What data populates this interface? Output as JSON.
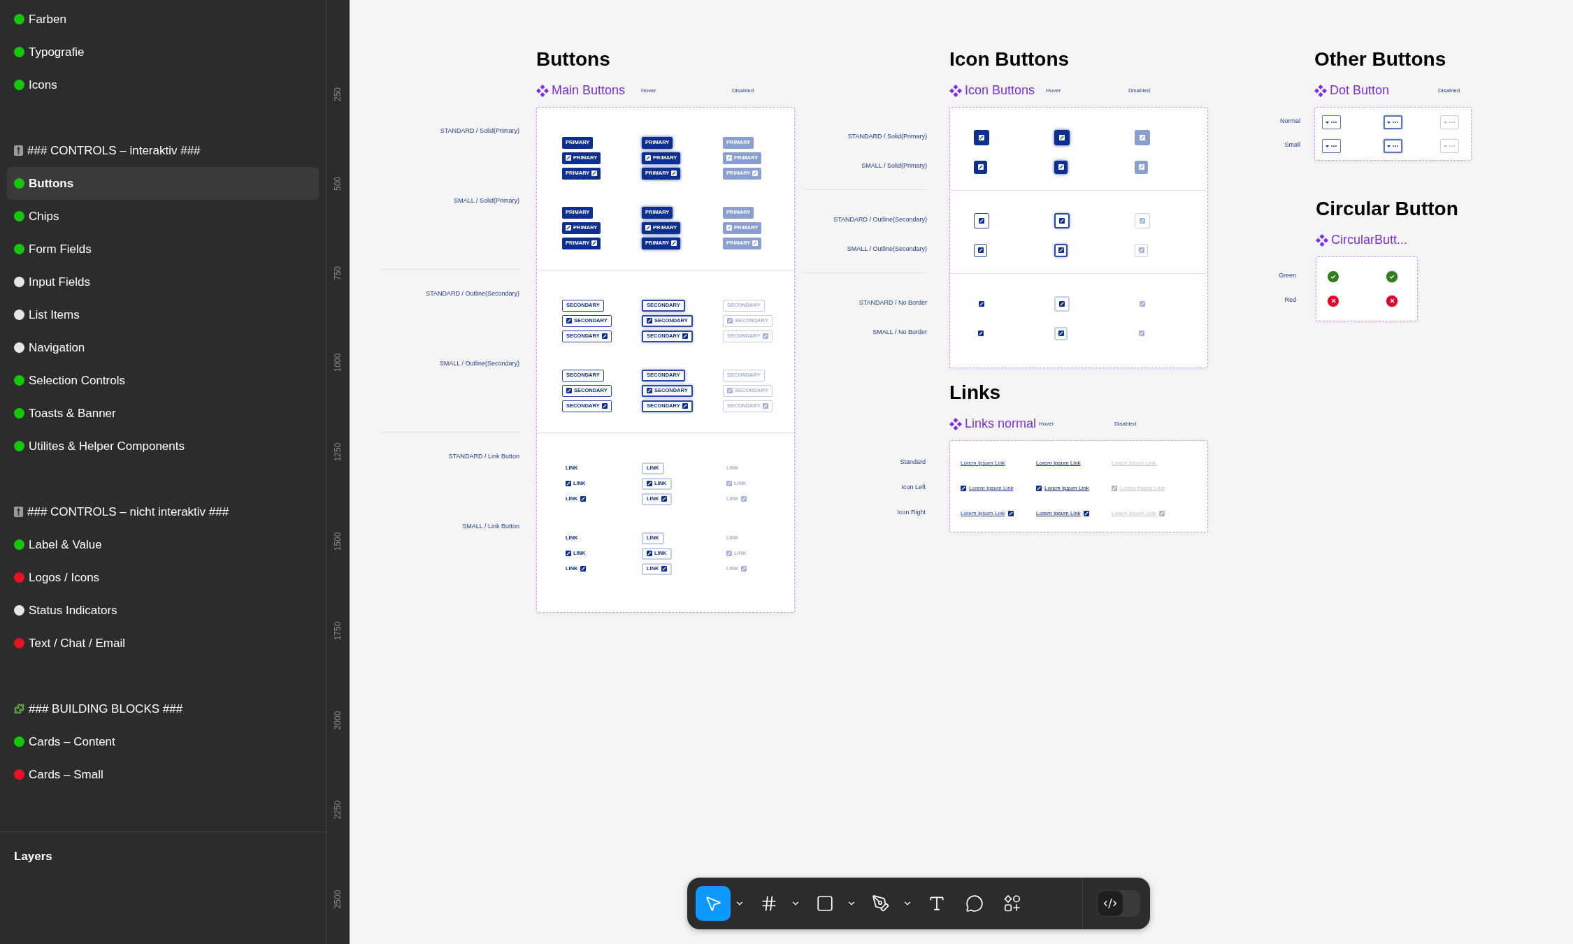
{
  "sidebar": {
    "groups": [
      {
        "items": [
          {
            "label": "Farben",
            "color": "#16c60c",
            "selected": false
          },
          {
            "label": "Typografie",
            "color": "#16c60c",
            "selected": false
          },
          {
            "label": "Icons",
            "color": "#16c60c",
            "selected": false
          }
        ]
      },
      {
        "header": {
          "kind": "controls",
          "label": "### CONTROLS – interaktiv ###"
        },
        "items": [
          {
            "label": "Buttons",
            "color": "#16c60c",
            "selected": true
          },
          {
            "label": "Chips",
            "color": "#16c60c",
            "selected": false
          },
          {
            "label": "Form Fields",
            "color": "#16c60c",
            "selected": false
          },
          {
            "label": "Input Fields",
            "color": "#e6e6e6",
            "selected": false
          },
          {
            "label": "List Items",
            "color": "#e6e6e6",
            "selected": false
          },
          {
            "label": "Navigation",
            "color": "#e6e6e6",
            "selected": false
          },
          {
            "label": "Selection Controls",
            "color": "#16c60c",
            "selected": false
          },
          {
            "label": "Toasts & Banner",
            "color": "#16c60c",
            "selected": false
          },
          {
            "label": "Utilites & Helper Components",
            "color": "#16c60c",
            "selected": false
          }
        ]
      },
      {
        "header": {
          "kind": "controls",
          "label": "### CONTROLS – nicht interaktiv ###"
        },
        "items": [
          {
            "label": "Label & Value",
            "color": "#16c60c",
            "selected": false
          },
          {
            "label": "Logos / Icons",
            "color": "#e81224",
            "selected": false
          },
          {
            "label": "Status Indicators",
            "color": "#e6e6e6",
            "selected": false
          },
          {
            "label": "Text / Chat / Email",
            "color": "#e81224",
            "selected": false
          }
        ]
      },
      {
        "header": {
          "kind": "blocks",
          "label": "### BUILDING BLOCKS ###"
        },
        "items": [
          {
            "label": "Cards – Content",
            "color": "#16c60c",
            "selected": false
          },
          {
            "label": "Cards – Small",
            "color": "#e81224",
            "selected": false
          }
        ]
      }
    ],
    "layers_title": "Layers"
  },
  "ruler": {
    "labels": [
      "250",
      "500",
      "750",
      "1000",
      "1250",
      "1500",
      "1750",
      "2000",
      "2250",
      "2500"
    ]
  },
  "main_buttons": {
    "title": "Buttons",
    "component": "Main Buttons",
    "columns": [
      {
        "kind": "default"
      },
      {
        "label": "Hover",
        "kind": "hover"
      },
      {
        "label": "Disabled",
        "kind": "disabled"
      }
    ],
    "groups": [
      {
        "rows": [
          {
            "label": "STANDARD / Solid(Primary)",
            "kind": "solid",
            "cells": [
              [
                {
                  "kind": "plain",
                  "text": "PRIMARY"
                },
                {
                  "kind": "icon-left",
                  "text": "PRIMARY"
                },
                {
                  "kind": "icon-right",
                  "text": "PRIMARY"
                }
              ],
              [
                {
                  "kind": "plain",
                  "text": "PRIMARY"
                },
                {
                  "kind": "icon-left",
                  "text": "PRIMARY"
                },
                {
                  "kind": "icon-right",
                  "text": "PRIMARY"
                }
              ],
              [
                {
                  "kind": "plain",
                  "text": "PRIMARY"
                },
                {
                  "kind": "icon-left",
                  "text": "PRIMARY"
                },
                {
                  "kind": "icon-right",
                  "text": "PRIMARY"
                }
              ]
            ]
          },
          {
            "label": "SMALL / Solid(Primary)",
            "kind": "solid",
            "cells": [
              [
                {
                  "kind": "plain",
                  "text": "PRIMARY"
                },
                {
                  "kind": "icon-left",
                  "text": "PRIMARY"
                },
                {
                  "kind": "icon-right",
                  "text": "PRIMARY"
                }
              ],
              [
                {
                  "kind": "plain",
                  "text": "PRIMARY"
                },
                {
                  "kind": "icon-left",
                  "text": "PRIMARY"
                },
                {
                  "kind": "icon-right",
                  "text": "PRIMARY"
                }
              ],
              [
                {
                  "kind": "plain",
                  "text": "PRIMARY"
                },
                {
                  "kind": "icon-left",
                  "text": "PRIMARY"
                },
                {
                  "kind": "icon-right",
                  "text": "PRIMARY"
                }
              ]
            ]
          }
        ]
      },
      {
        "rows": [
          {
            "label": "STANDARD / Outline(Secondary)",
            "kind": "outline",
            "cells": [
              [
                {
                  "kind": "plain",
                  "text": "SECONDARY"
                },
                {
                  "kind": "icon-left",
                  "text": "SECONDARY"
                },
                {
                  "kind": "icon-right",
                  "text": "SECONDARY"
                }
              ],
              [
                {
                  "kind": "plain",
                  "text": "SECONDARY"
                },
                {
                  "kind": "icon-left",
                  "text": "SECONDARY"
                },
                {
                  "kind": "icon-right",
                  "text": "SECONDARY"
                }
              ],
              [
                {
                  "kind": "plain",
                  "text": "SECONDARY"
                },
                {
                  "kind": "icon-left",
                  "text": "SECONDARY"
                },
                {
                  "kind": "icon-right",
                  "text": "SECONDARY"
                }
              ]
            ]
          },
          {
            "label": "SMALL / Outline(Secondary)",
            "kind": "outline",
            "cells": [
              [
                {
                  "kind": "plain",
                  "text": "SECONDARY"
                },
                {
                  "kind": "icon-left",
                  "text": "SECONDARY"
                },
                {
                  "kind": "icon-right",
                  "text": "SECONDARY"
                }
              ],
              [
                {
                  "kind": "plain",
                  "text": "SECONDARY"
                },
                {
                  "kind": "icon-left",
                  "text": "SECONDARY"
                },
                {
                  "kind": "icon-right",
                  "text": "SECONDARY"
                }
              ],
              [
                {
                  "kind": "plain",
                  "text": "SECONDARY"
                },
                {
                  "kind": "icon-left",
                  "text": "SECONDARY"
                },
                {
                  "kind": "icon-right",
                  "text": "SECONDARY"
                }
              ]
            ]
          }
        ]
      },
      {
        "rows": [
          {
            "label": "STANDARD / Link Button",
            "kind": "link",
            "cells": [
              [
                {
                  "kind": "plain",
                  "text": "LINK"
                },
                {
                  "kind": "icon-left",
                  "text": "LINK"
                },
                {
                  "kind": "icon-right",
                  "text": "LINK"
                }
              ],
              [
                {
                  "kind": "plain",
                  "text": "LINK"
                },
                {
                  "kind": "icon-left",
                  "text": "LINK"
                },
                {
                  "kind": "icon-right",
                  "text": "LINK"
                }
              ],
              [
                {
                  "kind": "plain",
                  "text": "LINK"
                },
                {
                  "kind": "icon-left",
                  "text": "LINK"
                },
                {
                  "kind": "icon-right",
                  "text": "LINK"
                }
              ]
            ]
          },
          {
            "label": "SMALL / Link Button",
            "kind": "link",
            "cells": [
              [
                {
                  "kind": "plain",
                  "text": "LINK"
                },
                {
                  "kind": "icon-left",
                  "text": "LINK"
                },
                {
                  "kind": "icon-right",
                  "text": "LINK"
                }
              ],
              [
                {
                  "kind": "plain",
                  "text": "LINK"
                },
                {
                  "kind": "icon-left",
                  "text": "LINK"
                },
                {
                  "kind": "icon-right",
                  "text": "LINK"
                }
              ],
              [
                {
                  "kind": "plain",
                  "text": "LINK"
                },
                {
                  "kind": "icon-left",
                  "text": "LINK"
                },
                {
                  "kind": "icon-right",
                  "text": "LINK"
                }
              ]
            ]
          }
        ]
      }
    ]
  },
  "icon_buttons": {
    "title": "Icon Buttons",
    "component": "Icon Buttons",
    "columns": [
      {
        "kind": "default"
      },
      {
        "label": "Hover",
        "kind": "hover"
      },
      {
        "label": "Disabled",
        "kind": "disabled"
      }
    ],
    "groups": [
      {
        "rows": [
          {
            "label": "STANDARD / Solid(Primary)",
            "kind": "solid"
          },
          {
            "label": "SMALL / Solid(Primary)",
            "kind": "solid-small"
          }
        ]
      },
      {
        "rows": [
          {
            "label": "STANDARD / Outline(Secondary)",
            "kind": "outline"
          },
          {
            "label": "SMALL / Outline(Secondary)",
            "kind": "outline-small"
          }
        ]
      },
      {
        "rows": [
          {
            "label": "STANDARD / No Border",
            "kind": "borderless"
          },
          {
            "label": "SMALL / No Border",
            "kind": "borderless-small"
          }
        ]
      }
    ]
  },
  "links": {
    "title": "Links",
    "component": "Links normal",
    "columns": [
      {
        "kind": "default"
      },
      {
        "label": "Hover",
        "kind": "hover"
      },
      {
        "label": "Disabled",
        "kind": "disabled"
      }
    ],
    "groups": [
      {
        "rows": [
          {
            "label": "Standard",
            "kind": "plain",
            "cells": [
              "Lorem Ipsum Link",
              "Lorem Ipsum Link",
              "Lorem Ipsum Link"
            ]
          },
          {
            "label": "Icon Left",
            "kind": "icon-left",
            "cells": [
              "Lorem Ipsum Link",
              "Lorem Ipsum Link",
              "Lorem Ipsum Link"
            ]
          },
          {
            "label": "Icon Right",
            "kind": "icon-right",
            "cells": [
              "Lorem Ipsum Link",
              "Lorem Ipsum Link",
              "Lorem Ipsum Link"
            ]
          }
        ]
      }
    ]
  },
  "other_buttons": {
    "title": "Other Buttons",
    "component": "Dot Button",
    "columns": [
      {
        "kind": "default"
      },
      {
        "kind": "hover"
      },
      {
        "label": "Disabled",
        "kind": "disabled"
      }
    ],
    "groups": [
      {
        "rows": [
          {
            "label": "Normal"
          },
          {
            "label": "Small"
          }
        ]
      }
    ]
  },
  "circular": {
    "title": "Circular Button",
    "component": "CircularButt...",
    "columns": [
      {
        "kind": "default"
      },
      {
        "kind": "hover"
      }
    ],
    "groups": [
      {
        "rows": [
          {
            "label": "Green",
            "kind": "success"
          },
          {
            "label": "Red",
            "kind": "error"
          }
        ]
      }
    ]
  },
  "toolbar": {
    "tools": [
      {
        "kind": "move",
        "selected": true,
        "menu": true
      },
      {
        "kind": "frame",
        "selected": false,
        "menu": true
      },
      {
        "kind": "rectangle",
        "selected": false,
        "menu": true
      },
      {
        "kind": "pen",
        "selected": false,
        "menu": true
      },
      {
        "kind": "text",
        "selected": false,
        "menu": false
      },
      {
        "kind": "comment",
        "selected": false,
        "menu": false
      },
      {
        "kind": "components",
        "selected": false,
        "menu": false
      }
    ],
    "dev_mode_on": false
  }
}
